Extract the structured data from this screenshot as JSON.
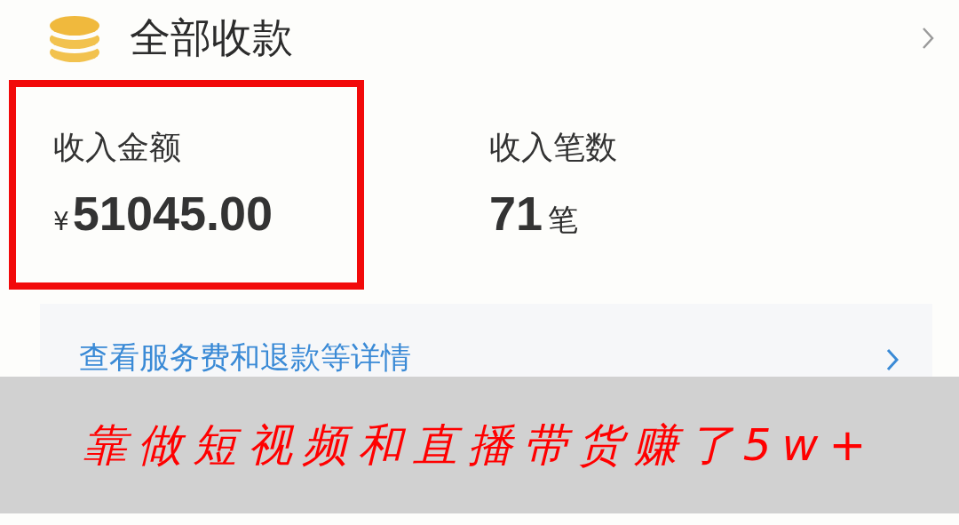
{
  "header": {
    "title": "全部收款"
  },
  "stats": [
    {
      "label": "收入金额",
      "prefix": "¥",
      "value": "51045.00",
      "highlighted": true
    },
    {
      "label": "收入笔数",
      "value": "71",
      "suffix": "笔",
      "highlighted": false
    }
  ],
  "detail_link": {
    "text": "查看服务费和退款等详情"
  },
  "caption": {
    "text": "靠做短视频和直播带货赚了5w+"
  }
}
